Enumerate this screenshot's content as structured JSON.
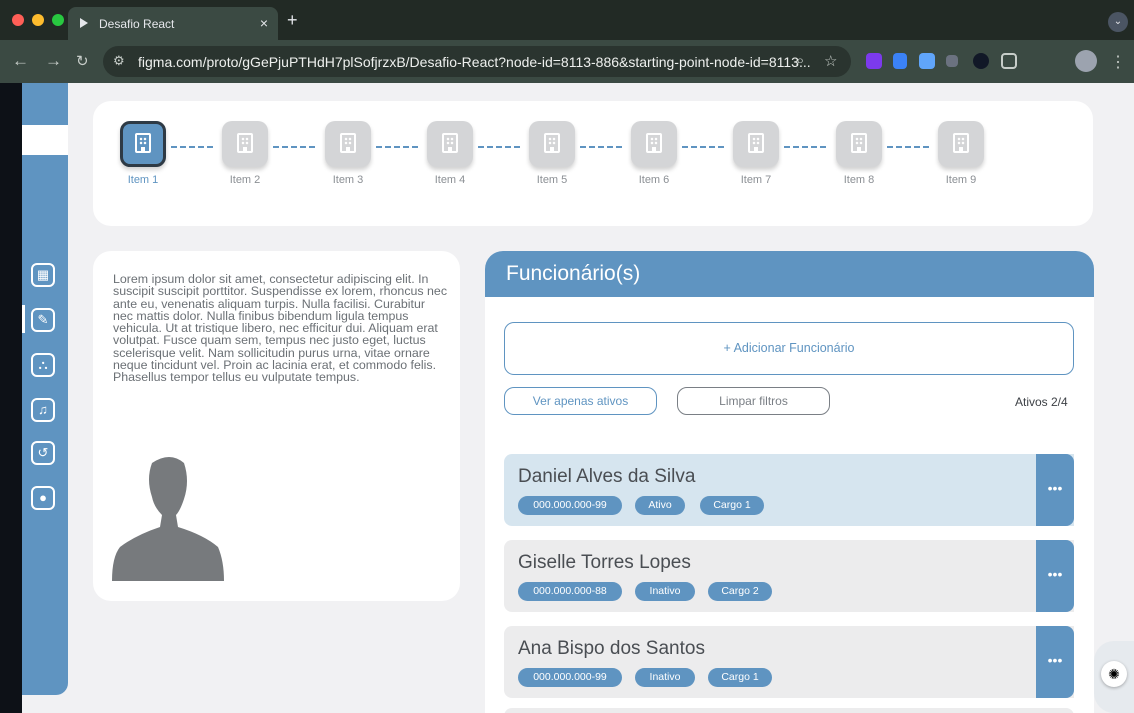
{
  "browser": {
    "tab_title": "Desafio React",
    "tab_close": "×",
    "new_tab": "+",
    "url": "figma.com/proto/gGePjuPTHdH7plSofjrzxB/Desafio-React?node-id=8113-886&starting-point-node-id=8113...",
    "icons": [
      "back-arrow-icon",
      "forward-arrow-icon",
      "reload-icon",
      "site-settings-icon",
      "zoom-icon",
      "bookmark-star-icon",
      "profile-avatar-icon",
      "menu-kebab-icon"
    ],
    "traffic_colors": [
      "#ff5f57",
      "#febc2e",
      "#28c840"
    ]
  },
  "sidebar": {
    "items": [
      {
        "icon": "building-icon",
        "glyph": "▦"
      },
      {
        "icon": "edit-icon",
        "glyph": "✎",
        "active": true
      },
      {
        "icon": "org-chart-icon",
        "glyph": "⛬"
      },
      {
        "icon": "bell-icon",
        "glyph": "♫"
      },
      {
        "icon": "history-icon",
        "glyph": "↺"
      },
      {
        "icon": "user-icon",
        "glyph": "●"
      }
    ]
  },
  "stepper": {
    "items": [
      {
        "label": "Item 1",
        "active": true
      },
      {
        "label": "Item 2"
      },
      {
        "label": "Item 3"
      },
      {
        "label": "Item 4"
      },
      {
        "label": "Item 5"
      },
      {
        "label": "Item 6"
      },
      {
        "label": "Item 7"
      },
      {
        "label": "Item 8"
      },
      {
        "label": "Item 9"
      }
    ]
  },
  "description": {
    "text": "Lorem ipsum dolor sit amet, consectetur adipiscing elit. In suscipit suscipit porttitor. Suspendisse ex lorem, rhoncus nec ante eu, venenatis aliquam turpis. Nulla facilisi. Curabitur nec mattis dolor. Nulla finibus bibendum ligula tempus vehicula. Ut at tristique libero, nec efficitur dui. Aliquam erat volutpat. Fusce quam sem, tempus nec justo eget, luctus scelerisque velit. Nam sollicitudin purus urna, vitae ornare neque tincidunt vel. Proin ac lacinia erat, et commodo felis. Phasellus tempor tellus eu vulputate tempus."
  },
  "funcionarios": {
    "title": "Funcionário(s)",
    "add_label": "+ Adicionar Funcionário",
    "filter_active_label": "Ver apenas ativos",
    "filter_clear_label": "Limpar filtros",
    "count_label": "Ativos 2/4",
    "menu_glyph": "•••",
    "employees": [
      {
        "name": "Daniel Alves da Silva",
        "cpf": "000.000.000-99",
        "status": "Ativo",
        "cargo": "Cargo 1",
        "selected": true
      },
      {
        "name": "Giselle Torres Lopes",
        "cpf": "000.000.000-88",
        "status": "Inativo",
        "cargo": "Cargo 2"
      },
      {
        "name": "Ana Bispo dos Santos",
        "cpf": "000.000.000-99",
        "status": "Inativo",
        "cargo": "Cargo 1"
      }
    ]
  },
  "theme": {
    "accent": "#5f94c1",
    "page_bg": "#f1f1f3",
    "inactive_step": "#d4d5d7"
  }
}
